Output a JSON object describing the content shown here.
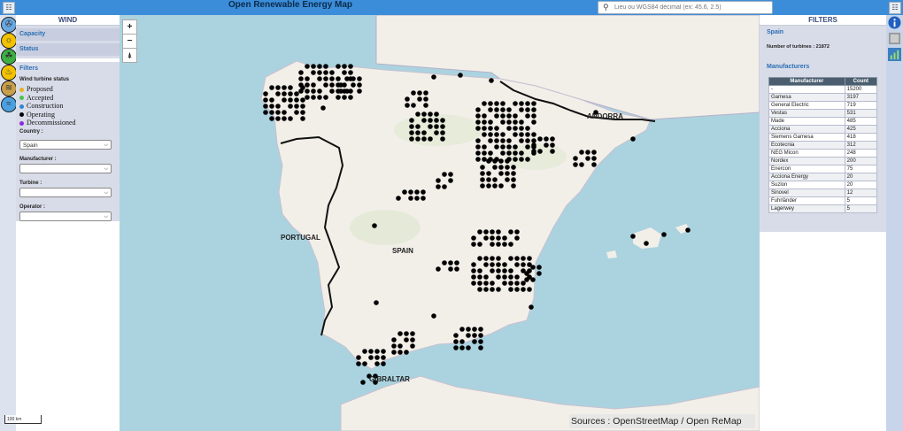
{
  "app": {
    "title": "Open Renewable Energy Map",
    "search_placeholder": "Lieu ou WGS84 décimal (ex: 45.6, 2.5)",
    "search_icon": "magnifier-icon",
    "menu_icon": "hamburger-icon"
  },
  "rail_icons": [
    {
      "name": "wind-icon",
      "glyph": "✇",
      "bg": "#6aa8e0"
    },
    {
      "name": "solar-icon",
      "glyph": "☼",
      "bg": "#f2c200"
    },
    {
      "name": "hydro-icon",
      "glyph": "☘",
      "bg": "#3cb043"
    },
    {
      "name": "geothermal-icon",
      "glyph": "♨",
      "bg": "#f2c200"
    },
    {
      "name": "biomass-icon",
      "glyph": "≋",
      "bg": "#c9a04a"
    },
    {
      "name": "marine-icon",
      "glyph": "≈",
      "bg": "#4aa0e0"
    }
  ],
  "left_panel": {
    "title": "WIND",
    "sections": [
      "Capacity",
      "Status"
    ],
    "filters_title": "Filters",
    "status_title": "Wind turbine status",
    "legend": [
      {
        "label": "Proposed",
        "color": "#e8b020"
      },
      {
        "label": "Accepted",
        "color": "#4cc24c"
      },
      {
        "label": "Construction",
        "color": "#2e86d6"
      },
      {
        "label": "Operating",
        "color": "#000000"
      },
      {
        "label": "Decommissioned",
        "color": "#8a2be2"
      }
    ],
    "country_label": "Country :",
    "country_value": "Spain",
    "manufacturer_label": "Manufacturer :",
    "turbine_label": "Turbine :",
    "operator_label": "Operator :"
  },
  "map": {
    "labels": [
      "ANDORRA",
      "PORTUGAL",
      "SPAIN",
      "GIBRALTAR"
    ],
    "zoom_in": "+",
    "zoom_out": "−",
    "reset": "⍋",
    "sources": "Sources : OpenStreetMap / Open ReMap",
    "scale": "100 km"
  },
  "right_panel": {
    "title": "FILTERS",
    "country": "Spain",
    "turbines": "Number of turbines : 21872",
    "manufacturers_title": "Manufacturers",
    "table_headers": [
      "Manufacturer",
      "Count"
    ],
    "rows": [
      [
        "-",
        "15200"
      ],
      [
        "Gamesa",
        "3197"
      ],
      [
        "General Electric",
        "719"
      ],
      [
        "Vestas",
        "531"
      ],
      [
        "Made",
        "485"
      ],
      [
        "Acciona",
        "425"
      ],
      [
        "Siemens Gamesa",
        "418"
      ],
      [
        "Ecotecnia",
        "312"
      ],
      [
        "NEG Micon",
        "248"
      ],
      [
        "Nordex",
        "200"
      ],
      [
        "Enercon",
        "75"
      ],
      [
        "Acciona Energy",
        "20"
      ],
      [
        "Suzlon",
        "20"
      ],
      [
        "Sinovel",
        "12"
      ],
      [
        "Fuhrländer",
        "5"
      ],
      [
        "Lagerwey",
        "5"
      ]
    ]
  },
  "right_rail": [
    "info-icon",
    "layers-icon",
    "chart-icon"
  ]
}
